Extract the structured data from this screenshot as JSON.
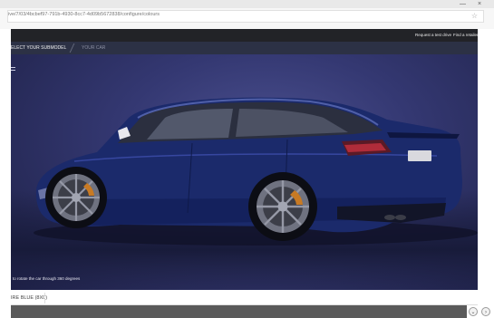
{
  "browser": {
    "url": "ive/7/03/4bcbef97-791b-4930-8cc7-4d09b5672838/configure/colours",
    "star_icon": "star-icon",
    "window_controls": [
      "—",
      "×"
    ]
  },
  "site_nav": {
    "links": [
      "Request a test drive",
      "Find a retailer"
    ]
  },
  "steps": {
    "select_submodel": "ELECT YOUR SUBMODEL",
    "your_car": "YOUR CAR"
  },
  "viewer": {
    "rotate_hint": "to rotate the car through 360 degrees",
    "car_colour": "#1b2a6b",
    "brand_accent": "#2c3145"
  },
  "colour": {
    "name": "IRE BLUE (8X0)"
  },
  "controls": {
    "scroll_down": "⌄",
    "scroll_side": "›"
  }
}
